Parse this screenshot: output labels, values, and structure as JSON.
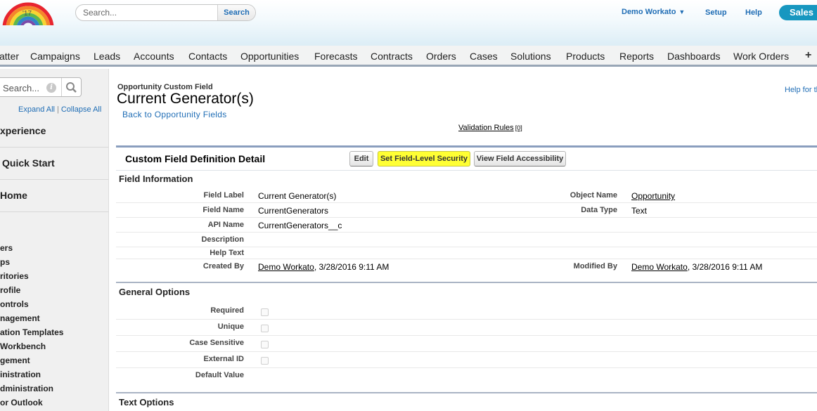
{
  "header": {
    "logo_text": "'17",
    "search_placeholder": "Search...",
    "search_button": "Search",
    "user_menu": "Demo Workato",
    "setup": "Setup",
    "help": "Help",
    "app_name": "Sales"
  },
  "tabs": [
    "atter",
    "Campaigns",
    "Leads",
    "Accounts",
    "Contacts",
    "Opportunities",
    "Forecasts",
    "Contracts",
    "Orders",
    "Cases",
    "Solutions",
    "Products",
    "Reports",
    "Dashboards",
    "Work Orders"
  ],
  "tab_plus": "+",
  "sidebar": {
    "search_placeholder": "Search...",
    "expand_all": "Expand All",
    "separator": "|",
    "collapse_all": "Collapse All",
    "sections": [
      "xperience",
      "Quick Start",
      "Home"
    ],
    "items": [
      "ers",
      "ps",
      "ritories",
      "rofile",
      "ontrols",
      "nagement",
      "ation Templates",
      " Workbench",
      "gement",
      "inistration",
      "dministration",
      "or Outlook"
    ]
  },
  "page": {
    "type_label": "Opportunity Custom Field",
    "title": "Current Generator(s)",
    "back_link": "Back to Opportunity Fields",
    "help_link": "Help for th",
    "validation_rules": "Validation Rules",
    "validation_count": "[0]"
  },
  "detail": {
    "title": "Custom Field Definition Detail",
    "buttons": {
      "edit": "Edit",
      "set_fls": "Set Field-Level Security",
      "view_access": "View Field Accessibility"
    },
    "field_info_title": "Field Information",
    "field_info": {
      "field_label_lbl": "Field Label",
      "field_label": "Current Generator(s)",
      "object_name_lbl": "Object Name",
      "object_name": "Opportunity",
      "field_name_lbl": "Field Name",
      "field_name": "CurrentGenerators",
      "data_type_lbl": "Data Type",
      "data_type": "Text",
      "api_name_lbl": "API Name",
      "api_name": "CurrentGenerators__c",
      "description_lbl": "Description",
      "help_text_lbl": "Help Text",
      "created_by_lbl": "Created By",
      "created_by_user": "Demo Workato",
      "created_by_date": ", 3/28/2016 9:11 AM",
      "modified_by_lbl": "Modified By",
      "modified_by_user": "Demo Workato",
      "modified_by_date": ", 3/28/2016 9:11 AM"
    },
    "general_title": "General Options",
    "general": {
      "required_lbl": "Required",
      "unique_lbl": "Unique",
      "case_sensitive_lbl": "Case Sensitive",
      "external_id_lbl": "External ID",
      "default_value_lbl": "Default Value"
    },
    "text_options_title": "Text Options"
  },
  "colors": {
    "link": "#1f6db5",
    "highlight": "#ffff33",
    "app_button": "#1797c0"
  }
}
